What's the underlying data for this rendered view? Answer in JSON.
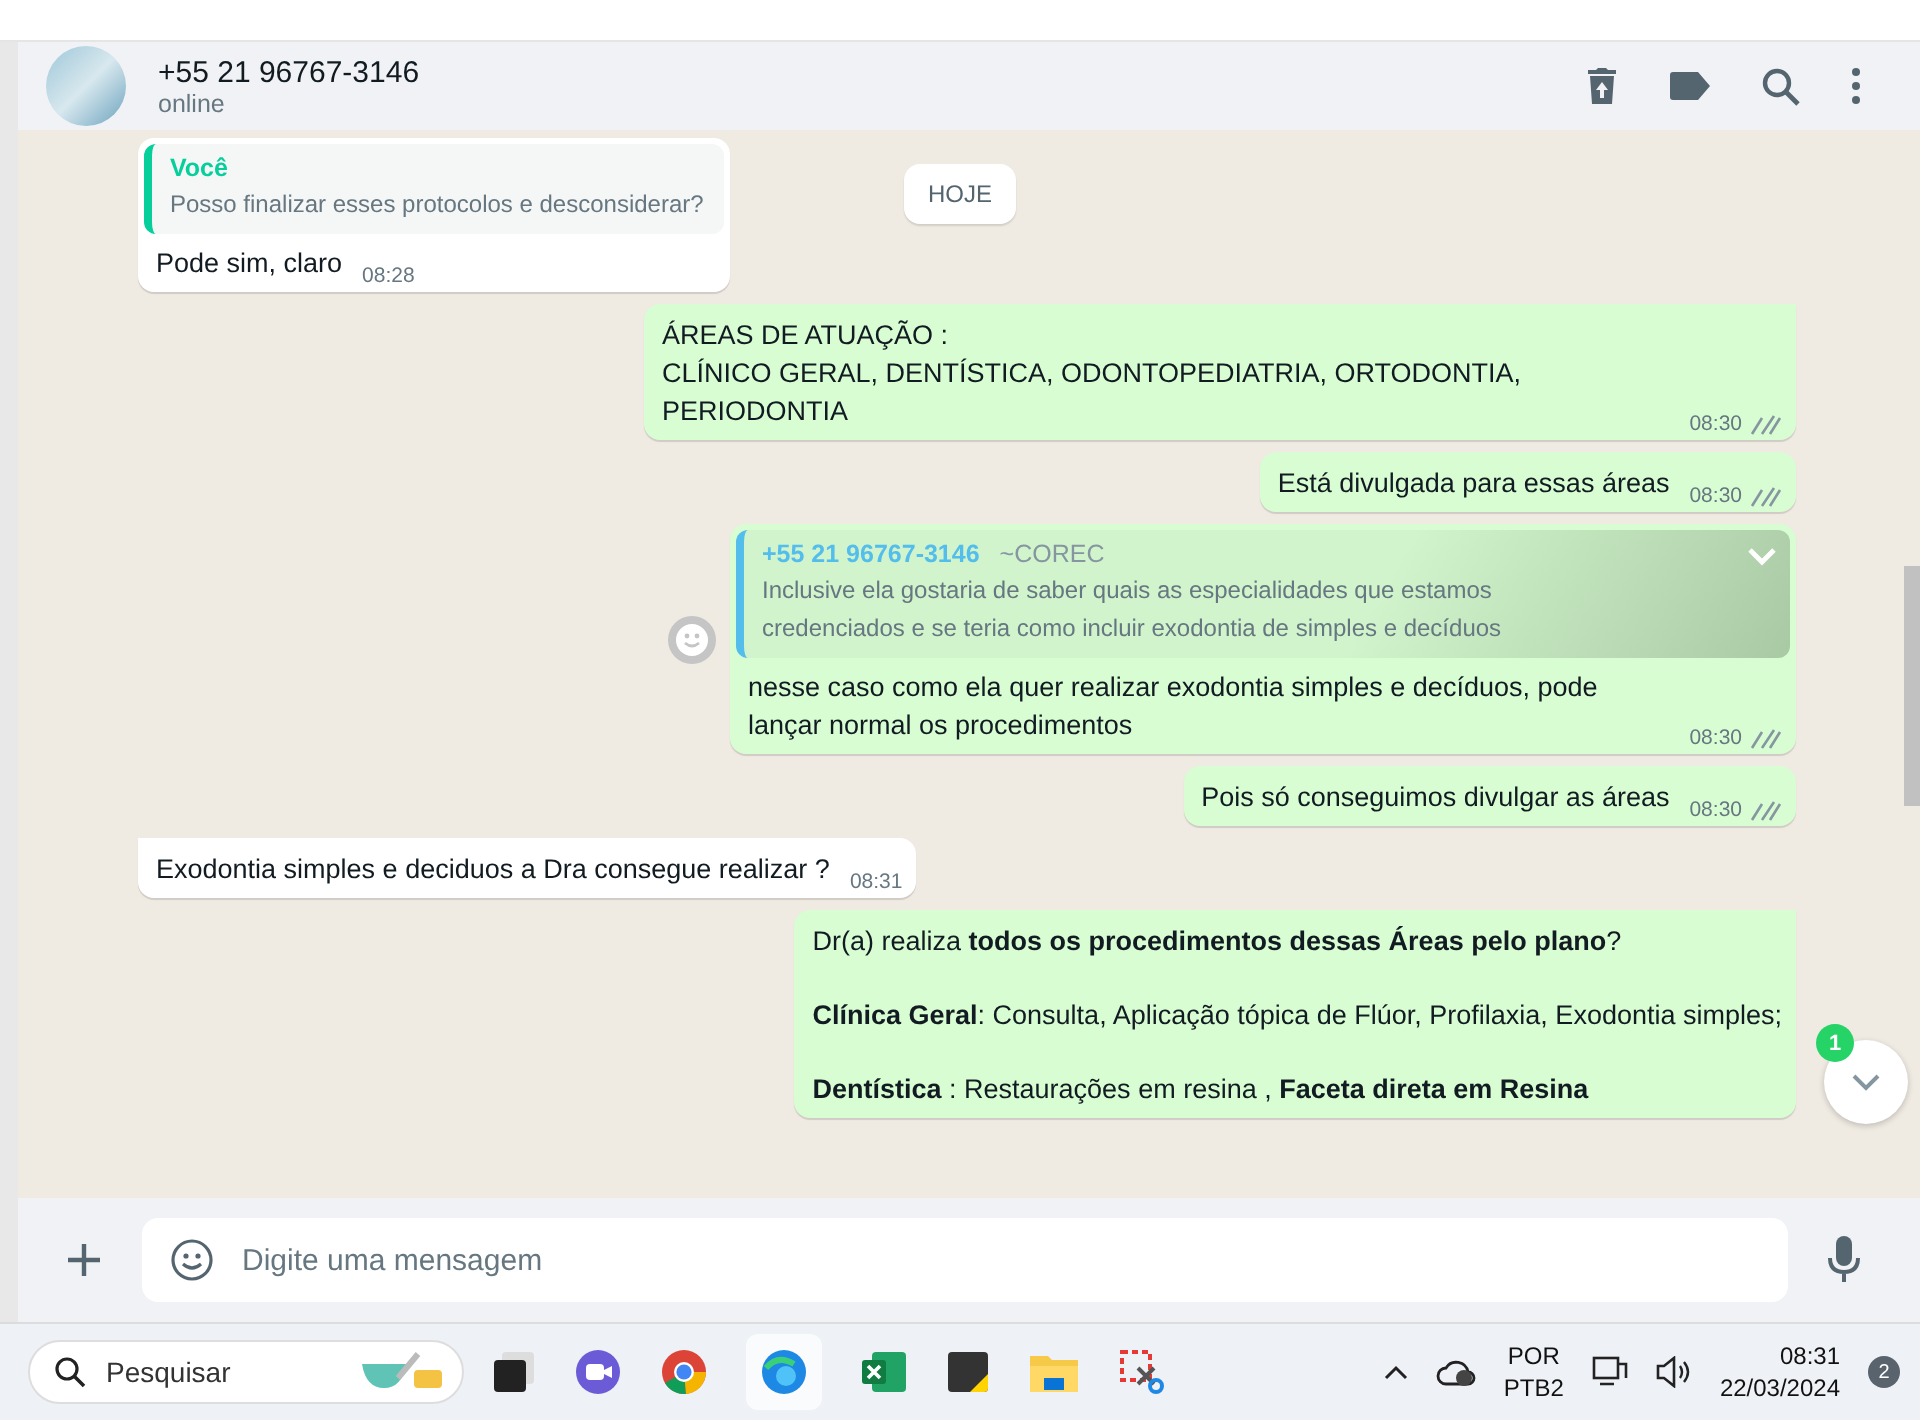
{
  "contact": {
    "name": "+55 21 96767-3146",
    "status": "online"
  },
  "day_chip": "HOJE",
  "messages": [
    {
      "kind": "in",
      "quote": {
        "author": "Você",
        "text": "Posso finalizar esses protocolos e desconsiderar?",
        "color": "#06cf9c"
      },
      "paragraphs": [
        [
          "Pode sim, claro"
        ]
      ],
      "time": "08:28"
    },
    {
      "kind": "out",
      "paragraphs": [
        [
          "ÁREAS DE ATUAÇÃO :",
          "CLÍNICO GERAL, DENTÍSTICA, ODONTOPEDIATRIA, ORTODONTIA, PERIODONTIA"
        ]
      ],
      "time": "08:30",
      "read": false,
      "tail": true
    },
    {
      "kind": "out",
      "paragraphs": [
        [
          "Está divulgada para essas áreas"
        ]
      ],
      "time": "08:30",
      "read": false
    },
    {
      "kind": "out",
      "quote": {
        "author": "+55 21 96767-3146",
        "alias": "~COREC",
        "text": "Inclusive ela gostaria de saber quais as especialidades que estamos credenciados e se teria como incluir exodontia de simples e decíduos",
        "color": "#53bdeb"
      },
      "paragraphs": [
        [
          "nesse caso como ela quer realizar exodontia simples e decíduos, pode lançar normal os procedimentos"
        ]
      ],
      "time": "08:30",
      "read": false,
      "react": true
    },
    {
      "kind": "out",
      "paragraphs": [
        [
          "Pois só conseguimos divulgar as áreas"
        ]
      ],
      "time": "08:30",
      "read": false
    },
    {
      "kind": "in",
      "paragraphs": [
        [
          "Exodontia simples e deciduos  a Dra consegue realizar ?"
        ]
      ],
      "time": "08:31",
      "tail": true
    },
    {
      "kind": "out",
      "paragraphs": [
        [
          "Dr(a) realiza **todos os procedimentos dessas Áreas pelo plano**?"
        ],
        [
          "**Clínica Geral**: Consulta, Aplicação tópica de Flúor, Profilaxia, Exodontia simples;"
        ],
        [
          "**Dentística**  : Restaurações em resina , **Faceta direta em Resina**"
        ]
      ],
      "tail": true
    }
  ],
  "unread_badge": "1",
  "composer": {
    "placeholder": "Digite uma mensagem"
  },
  "taskbar": {
    "search_placeholder": "Pesquisar",
    "language": "POR",
    "layout": "PTB2",
    "time": "08:31",
    "date": "22/03/2024",
    "notifications": "2"
  }
}
